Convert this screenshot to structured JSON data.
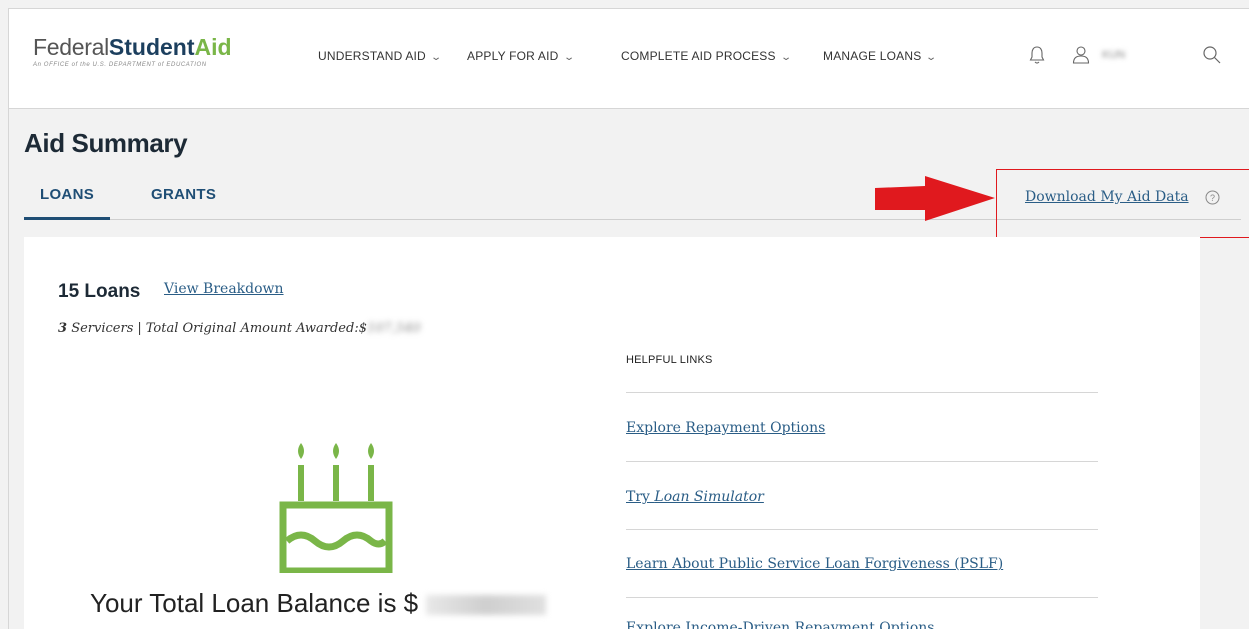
{
  "header": {
    "logo": {
      "federal": "Federal",
      "student": "Student",
      "aid": "Aid",
      "subtitle": "An OFFICE of the U.S. DEPARTMENT of EDUCATION"
    },
    "nav": [
      {
        "label": "UNDERSTAND AID"
      },
      {
        "label": "APPLY FOR AID"
      },
      {
        "label": "COMPLETE AID PROCESS"
      },
      {
        "label": "MANAGE LOANS"
      }
    ],
    "icons": [
      "bell-icon",
      "user-icon",
      "search-icon"
    ],
    "username": "KUN"
  },
  "page": {
    "title": "Aid Summary",
    "tabs": [
      {
        "label": "LOANS",
        "active": true
      },
      {
        "label": "GRANTS",
        "active": false
      }
    ],
    "download_link": "Download My Aid Data"
  },
  "summary": {
    "loan_count": "15 Loans",
    "view_breakdown": "View Breakdown",
    "servicers_count": "3",
    "servicers_label": "Servicers",
    "separator": "|",
    "original_amount_label": "Total Original Amount Awarded:$",
    "original_amount_value": "107,540",
    "balance_label": "Your Total Loan Balance is $"
  },
  "helpful_links": {
    "heading": "HELPFUL LINKS",
    "links": [
      {
        "label": "Explore Repayment Options"
      },
      {
        "prefix": "Try ",
        "italic": "Loan Simulator"
      },
      {
        "label": "Learn About Public Service Loan Forgiveness (PSLF)"
      },
      {
        "label": "Explore Income-Driven Repayment Options"
      }
    ]
  },
  "colors": {
    "brand_navy": "#1c3f5e",
    "brand_green": "#7ab648",
    "link_blue": "#2a5d86",
    "highlight_red": "#e0191e"
  }
}
